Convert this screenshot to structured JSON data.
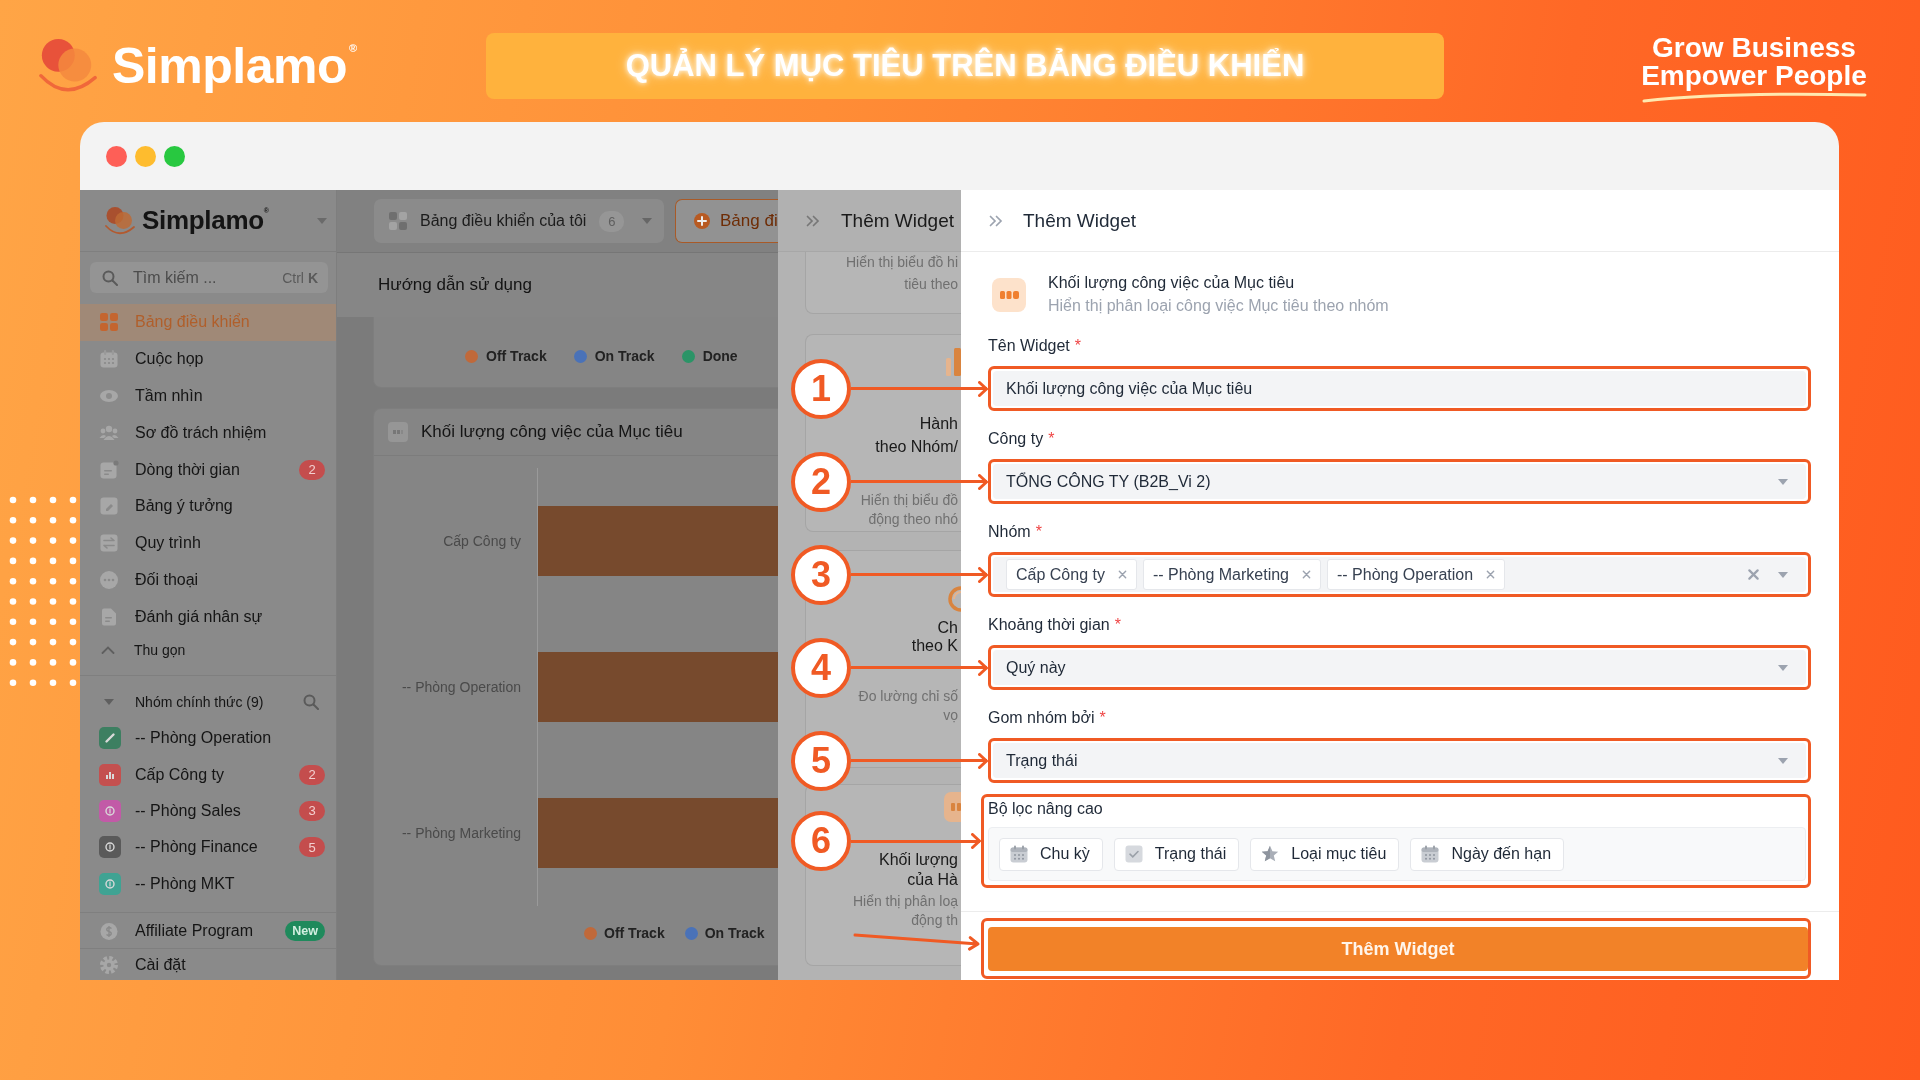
{
  "hero": {
    "logo": "Simplamo$^{®}$",
    "banner": "QUẢN LÝ MỤC TIÊU TRÊN BẢNG ĐIỀU KHIỂN",
    "tagline": [
      "Grow Business",
      "Empower People"
    ]
  },
  "sidebar": {
    "logo": "Simplamo$^{®}$",
    "search": {
      "placeholder": "Tìm kiếm ...",
      "shortcut": "Ctrl **K**"
    },
    "menu": [
      {
        "label": "Bảng điều khiển",
        "selected": true
      },
      {
        "label": "Cuộc họp",
        "selected": false
      },
      {
        "label": "Tầm nhìn",
        "selected": false
      },
      {
        "label": "Sơ đồ trách nhiệm",
        "selected": false
      },
      {
        "label": "Dòng thời gian",
        "selected": false,
        "badge": "2"
      },
      {
        "label": "Bảng ý tưởng",
        "selected": false
      },
      {
        "label": "Quy trình",
        "selected": false
      },
      {
        "label": "Đối thoại",
        "selected": false
      },
      {
        "label": "Đánh giá nhân sự",
        "selected": false
      }
    ],
    "collapse": "Thu gọn",
    "groups_header": {
      "label": "Nhóm chính thức (9)",
      "expanded": true
    },
    "groups": [
      {
        "label": "-- Phòng Operation",
        "color": "#3d7f61"
      },
      {
        "label": "Cấp Công ty",
        "color": "#c4504f",
        "badge": "2"
      },
      {
        "label": "-- Phòng Sales",
        "color": "#c25aa7",
        "badge": "3"
      },
      {
        "label": "-- Phòng Finance",
        "color": "#5a5a5a",
        "badge": "5"
      },
      {
        "label": "-- Phòng MKT",
        "color": "#3fa393"
      }
    ],
    "bottom_items": [
      {
        "label": "Affiliate Program",
        "tag": "New"
      },
      {
        "label": "Cài đặt"
      }
    ]
  },
  "dashboard": {
    "selector": {
      "label": "Bảng điều khiển của tôi",
      "count": "6"
    },
    "add_button": "Bảng đi",
    "guide_title": "Hướng dẫn sử dụng",
    "legend": [
      {
        "label": "Off Track",
        "color": "#c0693a"
      },
      {
        "label": "On Track",
        "color": "#4a72b8"
      },
      {
        "label": "Done",
        "color": "#2b9467"
      }
    ],
    "chart": {
      "title": "Khối lượng công việc của Mục tiêu",
      "categories": [
        "Cấp Công ty",
        "-- Phòng Operation",
        "-- Phòng Marketing"
      ],
      "legend": [
        {
          "label": "Off Track",
          "color": "#c0693a"
        },
        {
          "label": "On Track",
          "color": "#4a72b8"
        }
      ]
    }
  },
  "widget_drawer": {
    "title": "Thêm Widget",
    "cards": [
      {
        "description": [
          "Hiển thị biểu đồ hi",
          "tiêu theo"
        ]
      },
      {
        "title": [
          "Hành",
          "theo Nhóm/"
        ],
        "description": [
          "Hiển thị biểu đồ",
          "động theo nhó"
        ]
      },
      {
        "title": [
          "Ch",
          "theo K"
        ],
        "description": [
          "Đo lường chỉ số",
          "vọ"
        ]
      },
      {
        "title": [
          "Khối lượng",
          "của Hà"
        ],
        "description": [
          "Hiển thị phân loạ",
          "động th"
        ]
      }
    ]
  },
  "widget_form": {
    "title": "Thêm Widget",
    "widget": {
      "title": "Khối lượng công việc của Mục tiêu",
      "description": "Hiển thị phân loại công việc Mục tiêu theo nhóm"
    },
    "fields": [
      {
        "kind": "text",
        "label": "Tên Widget",
        "required_mark": "*",
        "value": "Khối lượng công việc của Mục tiêu",
        "marker": "1"
      },
      {
        "kind": "select",
        "label": "Công ty",
        "required_mark": "*",
        "value": "TỔNG CÔNG TY (B2B_Vi 2)",
        "marker": "2"
      },
      {
        "kind": "multiselect",
        "label": "Nhóm",
        "required_mark": "*",
        "tags": [
          "Cấp Công ty",
          "-- Phòng Marketing",
          "-- Phòng Operation"
        ],
        "marker": "3"
      },
      {
        "kind": "select",
        "label": "Khoảng thời gian",
        "required_mark": "*",
        "value": "Quý này",
        "marker": "4"
      },
      {
        "kind": "select",
        "label": "Gom nhóm bởi",
        "required_mark": "*",
        "value": "Trạng thái",
        "marker": "5"
      },
      {
        "kind": "filters",
        "label": "Bộ lọc nâng cao",
        "filters": [
          "Chu kỳ",
          "Trạng thái",
          "Loại mục tiêu",
          "Ngày đến hạn"
        ],
        "marker": "6"
      }
    ],
    "submit": {
      "label": "Thêm Widget",
      "highlighted": true
    }
  }
}
